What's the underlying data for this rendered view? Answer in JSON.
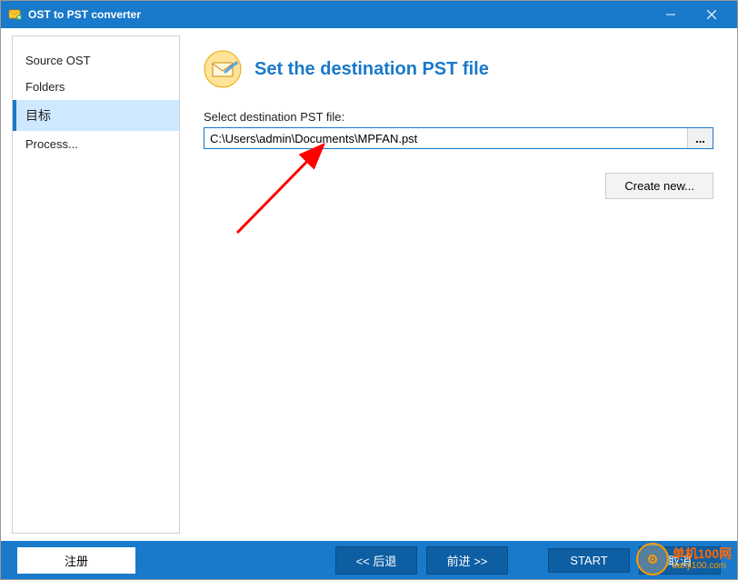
{
  "titlebar": {
    "title": "OST to PST converter"
  },
  "sidebar": {
    "items": [
      {
        "label": "Source OST",
        "active": false
      },
      {
        "label": "Folders",
        "active": false
      },
      {
        "label": "目标",
        "active": true
      },
      {
        "label": "Process...",
        "active": false
      }
    ]
  },
  "main": {
    "page_title": "Set the destination PST file",
    "field_label": "Select destination PST file:",
    "path_value": "C:\\Users\\admin\\Documents\\MPFAN.pst",
    "browse_label": "...",
    "create_new_label": "Create new..."
  },
  "footer": {
    "register": "注册",
    "back": "<< 后退",
    "forward": "前进 >>",
    "start": "START",
    "cancel": "取消"
  },
  "watermark": {
    "cn": "单机100网",
    "en": "danji100.com"
  }
}
